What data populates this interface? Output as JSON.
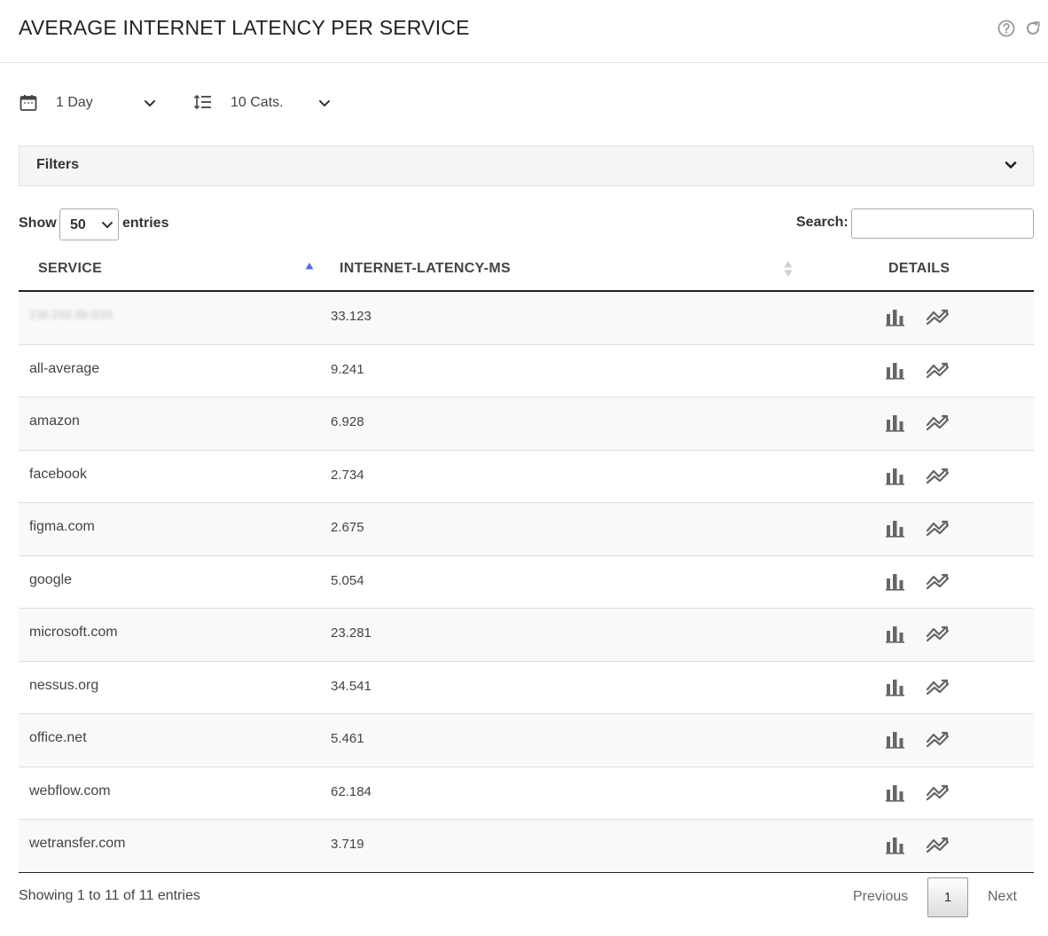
{
  "header": {
    "title": "AVERAGE INTERNET LATENCY PER SERVICE",
    "help_icon": "question-circle-icon",
    "refresh_icon": "refresh-icon"
  },
  "controls": {
    "period": {
      "icon": "calendar-icon",
      "value": "1 Day"
    },
    "categories": {
      "icon": "sort-list-icon",
      "value": "10 Cats."
    }
  },
  "filters": {
    "label": "Filters"
  },
  "table_controls": {
    "show_label": "Show",
    "entries_value": "50",
    "entries_label": "entries",
    "search_label": "Search:",
    "search_value": ""
  },
  "table": {
    "columns": [
      "SERVICE",
      "INTERNET-LATENCY-MS",
      "DETAILS"
    ],
    "rows": [
      {
        "service": "136.243.39.0/24",
        "latency": "33.123",
        "blurred": true
      },
      {
        "service": "all-average",
        "latency": "9.241"
      },
      {
        "service": "amazon",
        "latency": "6.928"
      },
      {
        "service": "facebook",
        "latency": "2.734"
      },
      {
        "service": "figma.com",
        "latency": "2.675"
      },
      {
        "service": "google",
        "latency": "5.054"
      },
      {
        "service": "microsoft.com",
        "latency": "23.281"
      },
      {
        "service": "nessus.org",
        "latency": "34.541"
      },
      {
        "service": "office.net",
        "latency": "5.461"
      },
      {
        "service": "webflow.com",
        "latency": "62.184"
      },
      {
        "service": "wetransfer.com",
        "latency": "3.719"
      }
    ],
    "detail_icons": [
      "bar-chart-icon",
      "trend-chart-icon"
    ]
  },
  "footer": {
    "info": "Showing 1 to 11 of 11 entries",
    "previous": "Previous",
    "current_page": "1",
    "next": "Next"
  },
  "colors": {
    "accent_sort": "#5b6ed6",
    "row_stripe": "#f9f9f9",
    "icon_gray": "#666666"
  }
}
